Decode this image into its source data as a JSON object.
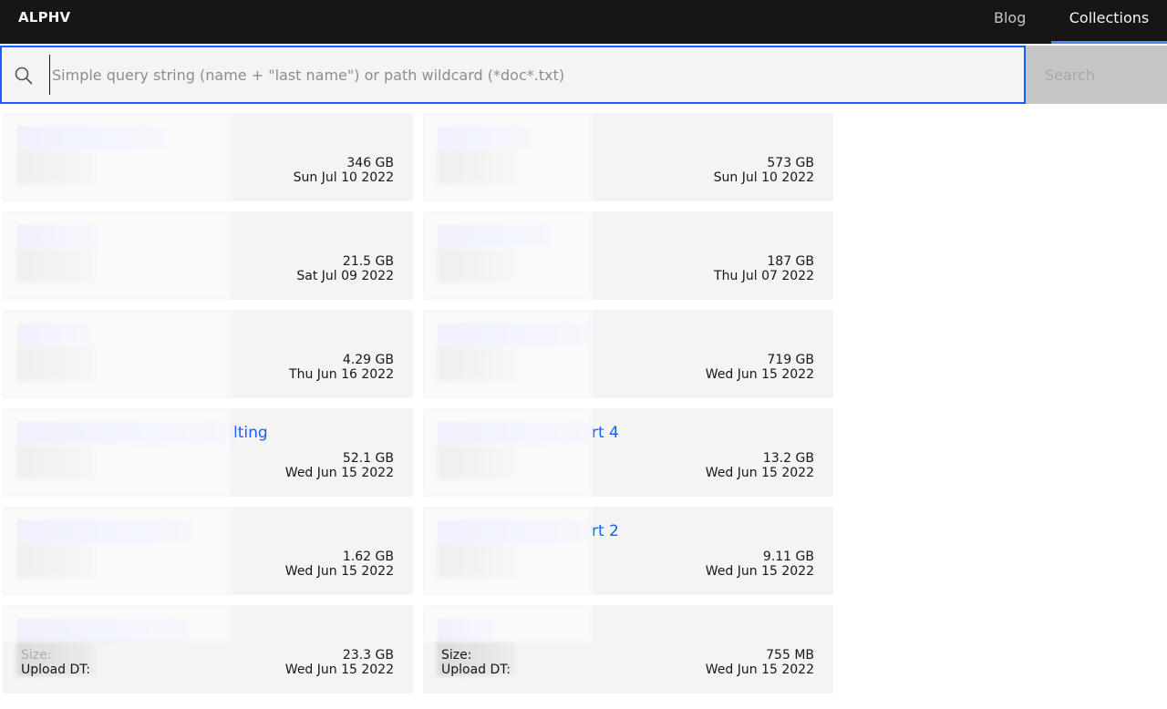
{
  "header": {
    "brand": "ALPHV",
    "nav": [
      {
        "label": "Blog"
      },
      {
        "label": "Collections"
      }
    ]
  },
  "search": {
    "placeholder": "Simple query string (name + \"last name\") or path wildcard (*doc*.txt)",
    "value": "",
    "button_label": "Search"
  },
  "collection_labels": {
    "size": "Size:",
    "upload": "Upload DT:"
  },
  "collections": [
    {
      "title_tail": "",
      "size": "346 GB",
      "date": "Sun Jul 10 2022"
    },
    {
      "title_tail": "",
      "size": "573 GB",
      "date": "Sun Jul 10 2022"
    },
    {
      "title_tail": "",
      "size": "21.5 GB",
      "date": "Sat Jul 09 2022"
    },
    {
      "title_tail": "",
      "size": "187 GB",
      "date": "Thu Jul 07 2022"
    },
    {
      "title_tail": "",
      "size": "4.29 GB",
      "date": "Thu Jun 16 2022"
    },
    {
      "title_tail": "",
      "size": "719 GB",
      "date": "Wed Jun 15 2022"
    },
    {
      "title_tail": "lting",
      "size": "52.1 GB",
      "date": "Wed Jun 15 2022"
    },
    {
      "title_tail": "rt 4",
      "size": "13.2 GB",
      "date": "Wed Jun 15 2022"
    },
    {
      "title_tail": "",
      "size": "1.62 GB",
      "date": "Wed Jun 15 2022"
    },
    {
      "title_tail": "rt 2",
      "size": "9.11 GB",
      "date": "Wed Jun 15 2022"
    },
    {
      "title_tail": "",
      "size": "23.3 GB",
      "date": "Wed Jun 15 2022"
    },
    {
      "title_tail": "",
      "size": "755 MB",
      "date": "Wed Jun 15 2022"
    }
  ]
}
